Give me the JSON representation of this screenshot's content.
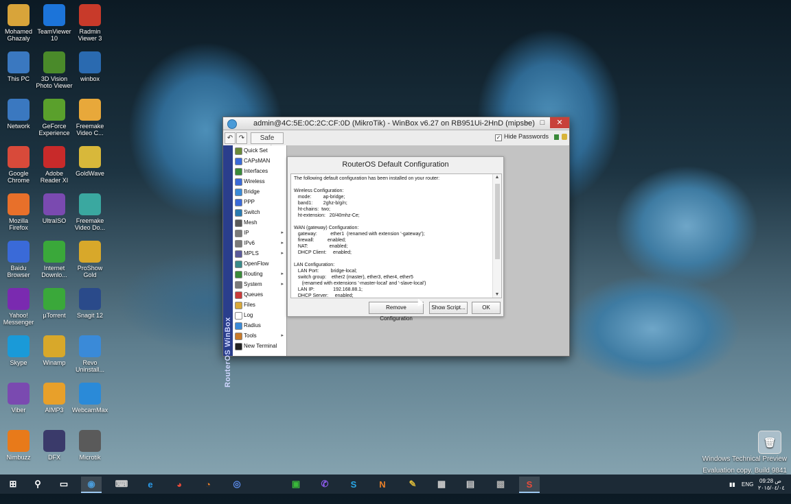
{
  "desktop_icons": [
    {
      "label": "Mohamed\nGhazaly",
      "icon": "folder-icon",
      "color": "#d8a43a"
    },
    {
      "label": "TeamViewer\n10",
      "icon": "teamviewer-icon",
      "color": "#1c74d9"
    },
    {
      "label": "Radmin\nViewer 3",
      "icon": "radmin-icon",
      "color": "#c83a2a"
    },
    {
      "label": "This PC",
      "icon": "computer-icon",
      "color": "#3a78c0"
    },
    {
      "label": "3D Vision\nPhoto Viewer",
      "icon": "3d-vision-icon",
      "color": "#4a8a2a"
    },
    {
      "label": "winbox",
      "icon": "winbox-icon",
      "color": "#2a6ab0"
    },
    {
      "label": "Network",
      "icon": "network-icon",
      "color": "#3a78c0"
    },
    {
      "label": "GeForce\nExperience",
      "icon": "geforce-icon",
      "color": "#5aa02c"
    },
    {
      "label": "Freemake\nVideo C...",
      "icon": "freemake-icon",
      "color": "#e8a83a"
    },
    {
      "label": "Google\nChrome",
      "icon": "chrome-icon",
      "color": "#d84a3a"
    },
    {
      "label": "Adobe\nReader XI",
      "icon": "adobe-reader-icon",
      "color": "#c82a2a"
    },
    {
      "label": "GoldWave",
      "icon": "goldwave-icon",
      "color": "#d8b83a"
    },
    {
      "label": "Mozilla\nFirefox",
      "icon": "firefox-icon",
      "color": "#e8702a"
    },
    {
      "label": "UltraISO",
      "icon": "ultraiso-icon",
      "color": "#7a4ab0"
    },
    {
      "label": "Freemake\nVideo Do...",
      "icon": "freemake-downloader-icon",
      "color": "#3aa8a0"
    },
    {
      "label": "Baidu\nBrowser",
      "icon": "baidu-icon",
      "color": "#3a6ad8"
    },
    {
      "label": "Internet\nDownlo...",
      "icon": "idm-icon",
      "color": "#3aa83a"
    },
    {
      "label": "ProShow\nGold",
      "icon": "proshow-icon",
      "color": "#d8a82a"
    },
    {
      "label": "Yahoo!\nMessenger",
      "icon": "yahoo-icon",
      "color": "#7a2ab0"
    },
    {
      "label": "µTorrent",
      "icon": "utorrent-icon",
      "color": "#3aa83a"
    },
    {
      "label": "Snagit 12",
      "icon": "snagit-icon",
      "color": "#2a4a8a"
    },
    {
      "label": "Skype",
      "icon": "skype-icon",
      "color": "#1a9ad8"
    },
    {
      "label": "Winamp",
      "icon": "winamp-icon",
      "color": "#d8a82a"
    },
    {
      "label": "Revo\nUninstall...",
      "icon": "revo-icon",
      "color": "#3a8ad8"
    },
    {
      "label": "Viber",
      "icon": "viber-icon",
      "color": "#7a4ab0"
    },
    {
      "label": "AIMP3",
      "icon": "aimp-icon",
      "color": "#e8a02a"
    },
    {
      "label": "WebcamMax",
      "icon": "webcammax-icon",
      "color": "#2a8ad8"
    },
    {
      "label": "Nimbuzz",
      "icon": "nimbuzz-icon",
      "color": "#e87a1a"
    },
    {
      "label": "DFX",
      "icon": "dfx-icon",
      "color": "#3a3a6a"
    },
    {
      "label": "Microtik",
      "icon": "mikrotik-icon",
      "color": "#5a5a5a"
    }
  ],
  "window": {
    "title": "admin@4C:5E:0C:2C:CF:0D (MikroTik) - WinBox v6.27 on RB951Ui-2HnD (mipsbe)",
    "minimize": "–",
    "maximize": "□",
    "close": "✕"
  },
  "toolbar": {
    "undo": "↶",
    "redo": "↷",
    "safe_mode": "Safe Mode",
    "hide_passwords": "Hide Passwords",
    "hide_passwords_checked": "✓"
  },
  "brand_vertical": "RouterOS WinBox",
  "menu": [
    {
      "label": "Quick Set",
      "color": "#6a8a3a",
      "arrow": ""
    },
    {
      "label": "CAPsMAN",
      "color": "#3a6ad8",
      "arrow": ""
    },
    {
      "label": "Interfaces",
      "color": "#3a8a3a",
      "arrow": ""
    },
    {
      "label": "Wireless",
      "color": "#3a6ad8",
      "arrow": ""
    },
    {
      "label": "Bridge",
      "color": "#3a8ad8",
      "arrow": ""
    },
    {
      "label": "PPP",
      "color": "#3a6ad8",
      "arrow": ""
    },
    {
      "label": "Switch",
      "color": "#2a7ab0",
      "arrow": ""
    },
    {
      "label": "Mesh",
      "color": "#5a5a5a",
      "arrow": ""
    },
    {
      "label": "IP",
      "color": "#7a7a7a",
      "arrow": "▸"
    },
    {
      "label": "IPv6",
      "color": "#7a7a7a",
      "arrow": "▸"
    },
    {
      "label": "MPLS",
      "color": "#5a5a9a",
      "arrow": "▸"
    },
    {
      "label": "OpenFlow",
      "color": "#3a8a8a",
      "arrow": ""
    },
    {
      "label": "Routing",
      "color": "#3a8a3a",
      "arrow": "▸"
    },
    {
      "label": "System",
      "color": "#7a7a7a",
      "arrow": "▸"
    },
    {
      "label": "Queues",
      "color": "#c83a3a",
      "arrow": ""
    },
    {
      "label": "Files",
      "color": "#d8a83a",
      "arrow": ""
    },
    {
      "label": "Log",
      "color": "#ffffff",
      "arrow": ""
    },
    {
      "label": "Radius",
      "color": "#3a8ad8",
      "arrow": ""
    },
    {
      "label": "Tools",
      "color": "#c87a2a",
      "arrow": "▸"
    },
    {
      "label": "New Terminal",
      "color": "#222222",
      "arrow": ""
    }
  ],
  "dialog": {
    "title": "RouterOS Default Configuration",
    "lines": [
      "The following default configuration has been installed on your router:",
      "",
      "Wireless Configuration:",
      "   mode:         ap-bridge;",
      "   band1:        2ghz-b/g/n;",
      "   ht-chains:  two;",
      "   ht-extension:   20/40mhz-Ce;",
      "",
      "WAN (gateway) Configuration:",
      "   gateway:          ether1  (renamed with extension '-gateway');",
      "   firewall:          enabled;",
      "   NAT:                enabled;",
      "   DHCP Client:     enabled;",
      "",
      "LAN Configuration:",
      "   LAN Port:         bridge-local;",
      "   switch group:    ether2 (master), ether3, ether4, ether5",
      "      (renamed with extensions '-master-local' and '-slave-local')",
      "   LAN IP:              192.168.88.1;",
      "   DHCP Server:     enabled;"
    ],
    "remove_button": "Remove Configuration",
    "show_script_button": "Show Script...",
    "ok_button": "OK"
  },
  "taskbar": {
    "apps": [
      {
        "glyph": "⊞",
        "icon": "windows-start-icon",
        "color": "#ffffff"
      },
      {
        "glyph": "⚲",
        "icon": "search-icon",
        "color": "#ffffff"
      },
      {
        "glyph": "▭",
        "icon": "task-view-icon",
        "color": "#ffffff"
      },
      {
        "glyph": "◉",
        "icon": "winbox-taskbar-icon",
        "color": "#4a9bd8"
      },
      {
        "glyph": "⌨",
        "icon": "app-taskbar-icon",
        "color": "#cccccc"
      },
      {
        "glyph": "e",
        "icon": "ie-icon",
        "color": "#2a9ae8"
      },
      {
        "glyph": "◕",
        "icon": "chrome-taskbar-icon",
        "color": "#e84a3a"
      },
      {
        "glyph": "◔",
        "icon": "firefox-taskbar-icon",
        "color": "#e8802a"
      },
      {
        "glyph": "◎",
        "icon": "baidu-taskbar-icon",
        "color": "#5a8ae8"
      },
      {
        "glyph": "▣",
        "icon": "store-taskbar-icon",
        "color": "#3ab83a"
      },
      {
        "glyph": "✆",
        "icon": "viber-taskbar-icon",
        "color": "#8a5ae8"
      },
      {
        "glyph": "S",
        "icon": "skype-taskbar-icon",
        "color": "#2aa8e8"
      },
      {
        "glyph": "N",
        "icon": "nimbuzz-taskbar-icon",
        "color": "#e8802a"
      },
      {
        "glyph": "✎",
        "icon": "paint-taskbar-icon",
        "color": "#d8b83a"
      },
      {
        "glyph": "▦",
        "icon": "calculator-taskbar-icon",
        "color": "#cccccc"
      },
      {
        "glyph": "▤",
        "icon": "notepad-taskbar-icon",
        "color": "#cccccc"
      },
      {
        "glyph": "▩",
        "icon": "screen-taskbar-icon",
        "color": "#aaaaaa"
      },
      {
        "glyph": "S",
        "icon": "snagit-taskbar-icon",
        "color": "#e84a3a"
      }
    ],
    "language": "ENG",
    "time": "09:28 ص",
    "date": "٢٠١٥/٠٤/٠٤"
  },
  "watermark": {
    "line1": "Windows Technical Preview",
    "line2": "Evaluation copy. Build 9841"
  },
  "recycle_bin_label": "Recycle Bin"
}
